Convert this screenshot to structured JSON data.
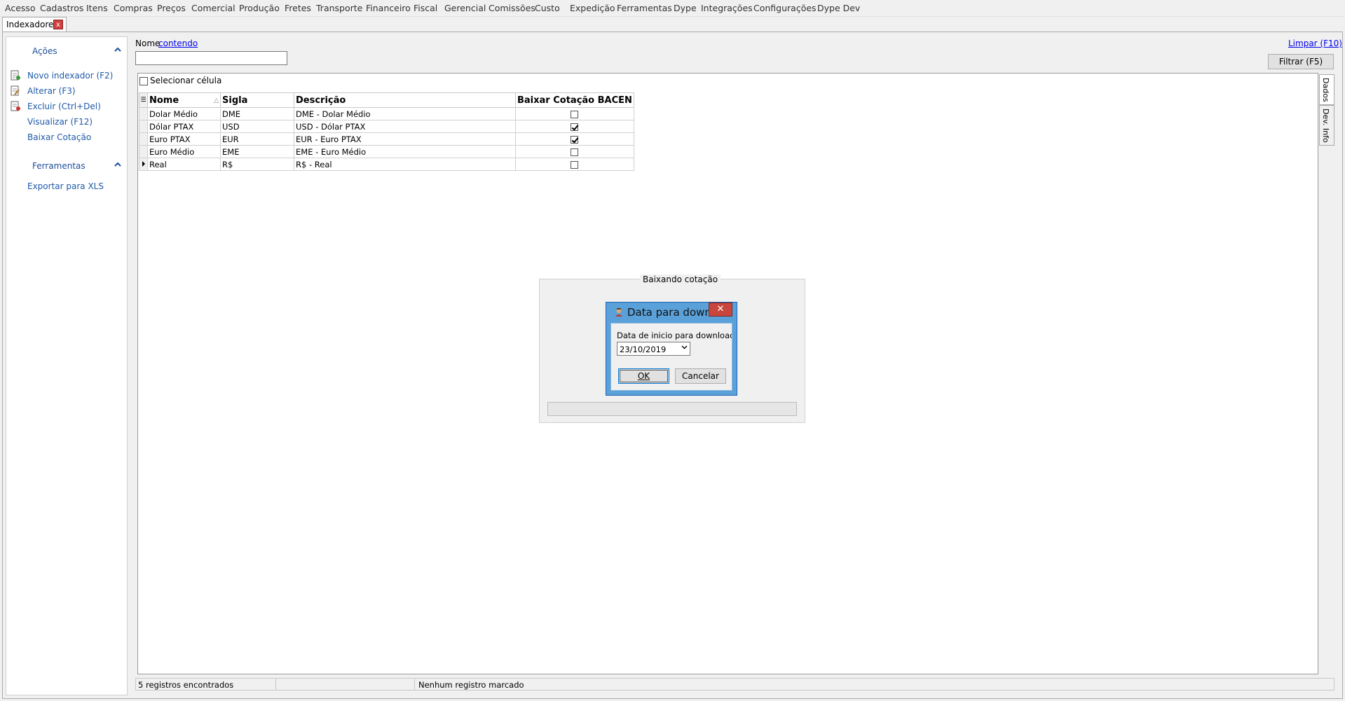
{
  "menu": [
    "Acesso",
    "Cadastros",
    "Itens",
    "Compras",
    "Preços",
    "Comercial",
    "Produção",
    "Fretes",
    "Transporte",
    "Financeiro",
    "Fiscal",
    "Gerencial",
    "Comissões",
    "Custo",
    "Expedição",
    "Ferramentas",
    "Dype",
    "Integrações",
    "Configurações",
    "Dype Dev"
  ],
  "tab": {
    "label": "Indexadores",
    "close": "x"
  },
  "sidebar": {
    "acoes_title": "Ações",
    "ferramentas_title": "Ferramentas",
    "chevron": "^",
    "actions": [
      {
        "label": "Novo indexador (F2)",
        "icon": "new-document-icon"
      },
      {
        "label": "Alterar (F3)",
        "icon": "edit-document-icon"
      },
      {
        "label": "Excluir (Ctrl+Del)",
        "icon": "delete-document-icon"
      },
      {
        "label": "Visualizar (F12)",
        "icon": ""
      },
      {
        "label": "Baixar Cotação",
        "icon": ""
      }
    ],
    "tools": [
      {
        "label": "Exportar para XLS"
      }
    ]
  },
  "filter": {
    "label": "Nome",
    "mode_link": "contendo",
    "value": "",
    "clear_link": "Limpar (F10)",
    "filter_button": "Filtrar (F5)"
  },
  "grid": {
    "select_cell_label": "Selecionar célula",
    "columns": [
      "Nome",
      "Sigla",
      "Descrição",
      "Baixar Cotação BACEN"
    ],
    "rows": [
      {
        "nome": "Dolar Médio",
        "sigla": "DME",
        "descricao": "DME - Dolar Médio",
        "baixar": false
      },
      {
        "nome": "Dólar PTAX",
        "sigla": "USD",
        "descricao": "USD - Dólar PTAX",
        "baixar": true
      },
      {
        "nome": "Euro  PTAX",
        "sigla": "EUR",
        "descricao": "EUR - Euro  PTAX",
        "baixar": true
      },
      {
        "nome": "Euro Médio",
        "sigla": "EME",
        "descricao": "EME - Euro Médio",
        "baixar": false
      },
      {
        "nome": "Real",
        "sigla": "R$",
        "descricao": "R$ - Real",
        "baixar": false
      }
    ],
    "current_row": 4
  },
  "side_tabs": [
    "Dados",
    "Dev. Info"
  ],
  "status": {
    "count": "5 registros encontrados",
    "marked": "Nenhum registro marcado"
  },
  "progress": {
    "title": "Baixando cotação"
  },
  "dialog": {
    "title": "Data para down...",
    "close": "✕",
    "label": "Data de inicio para download BACEN",
    "date": "23/10/2019",
    "ok": "OK",
    "cancel": "Cancelar"
  },
  "colors": {
    "link": "#1e5aa8",
    "dialog_frame": "#5aa1d9",
    "close_red": "#c9463d"
  }
}
